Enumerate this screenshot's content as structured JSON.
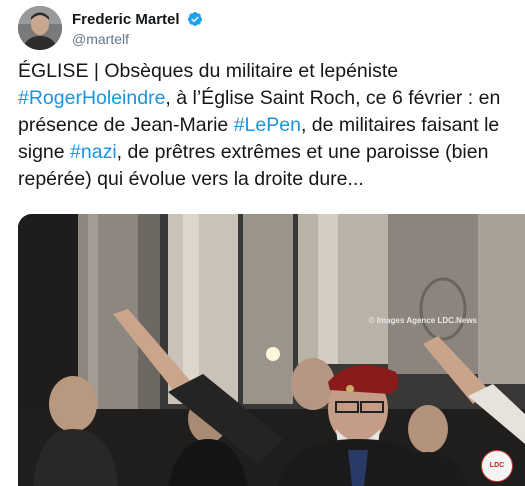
{
  "author": {
    "name": "Frederic Martel",
    "handle": "@martelf",
    "verified": true
  },
  "tweet": {
    "lines": [
      [
        {
          "text": "ÉGLISE | Obsèques du militaire et lepéniste",
          "hashtag": false
        }
      ],
      [
        {
          "text": "#RogerHoleindre",
          "hashtag": true
        },
        {
          "text": ", à l’Église Saint Roch, ce 6 février : en",
          "hashtag": false
        }
      ],
      [
        {
          "text": "présence de Jean-Marie ",
          "hashtag": false
        },
        {
          "text": "#LePen",
          "hashtag": true
        },
        {
          "text": ", de militaires faisant le",
          "hashtag": false
        }
      ],
      [
        {
          "text": "signe ",
          "hashtag": false
        },
        {
          "text": "#nazi",
          "hashtag": true
        },
        {
          "text": ", de prêtres extrêmes et une paroisse (bien",
          "hashtag": false
        }
      ],
      [
        {
          "text": "repérée) qui évolue vers la droite dure...",
          "hashtag": false
        }
      ]
    ]
  },
  "media": {
    "watermark": "© Images Agence LDC.News",
    "logo_text": "LDC NEWS"
  },
  "colors": {
    "hashtag": "#1b95e0",
    "verified": "#1da1f2",
    "beret": "#8b1a1a"
  }
}
